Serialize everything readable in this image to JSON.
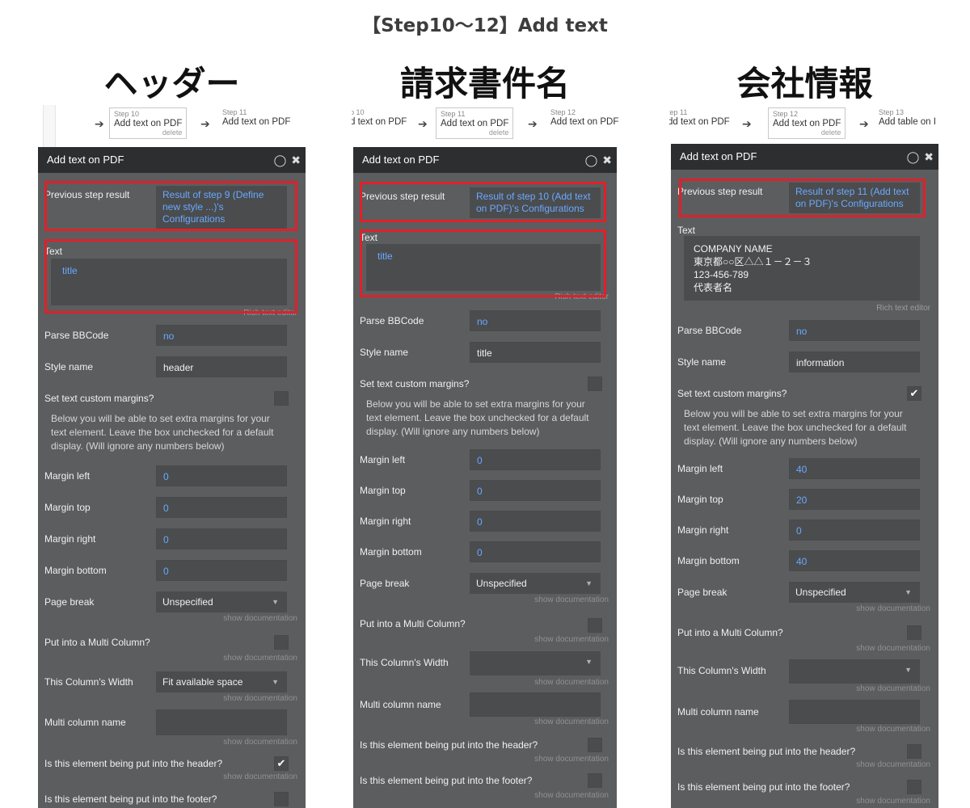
{
  "caption": "【Step10〜12】Add text",
  "columns": [
    {
      "title": "ヘッダー",
      "steps": {
        "prev": {
          "num": "Step 10",
          "label": "Add text on PDF",
          "delete": "delete"
        },
        "next": {
          "num": "Step 11",
          "label": "Add text on PDF"
        }
      },
      "panel_title": "Add text on PDF",
      "previous_step_label": "Previous step result",
      "previous_step_value": "Result of step 9 (Define new style ...)'s Configurations",
      "text_label": "Text",
      "text_value": "title",
      "rich_text": "Rich text editor",
      "parse_label": "Parse BBCode",
      "parse_value": "no",
      "style_label": "Style name",
      "style_value": "header",
      "margins_q": "Set text custom margins?",
      "margins_checked": false,
      "note": "Below you will be able to set extra margins for your text element. Leave the box unchecked for a default display. (Will ignore any numbers below)",
      "ml_label": "Margin left",
      "ml": "0",
      "mt_label": "Margin top",
      "mt": "0",
      "mr_label": "Margin right",
      "mr": "0",
      "mb_label": "Margin bottom",
      "mb": "0",
      "pb_label": "Page break",
      "pb": "Unspecified",
      "show_doc": "show documentation",
      "multi_label": "Put into a Multi Column?",
      "width_label": "This Column's Width",
      "width_value": "Fit available space",
      "mcname_label": "Multi column name",
      "header_q": "Is this element being put into the header?",
      "header_checked": true,
      "footer_q": "Is this element being put into the footer?"
    },
    {
      "title": "請求書件名",
      "steps": {
        "prev": {
          "num": "p 10",
          "label": "d text on PDF"
        },
        "sel": {
          "num": "Step 11",
          "label": "Add text on PDF",
          "delete": "delete"
        },
        "next": {
          "num": "Step 12",
          "label": "Add text on PDF"
        }
      },
      "panel_title": "Add text on PDF",
      "previous_step_label": "Previous step result",
      "previous_step_value": "Result of step 10 (Add text on PDF)'s Configurations",
      "text_label": "Text",
      "text_value": "title",
      "rich_text": "Rich text editor",
      "parse_label": "Parse BBCode",
      "parse_value": "no",
      "style_label": "Style name",
      "style_value": "title",
      "margins_q": "Set text custom margins?",
      "margins_checked": false,
      "note": "Below you will be able to set extra margins for your text element. Leave the box unchecked for a default display. (Will ignore any numbers below)",
      "ml_label": "Margin left",
      "ml": "0",
      "mt_label": "Margin top",
      "mt": "0",
      "mr_label": "Margin right",
      "mr": "0",
      "mb_label": "Margin bottom",
      "mb": "0",
      "pb_label": "Page break",
      "pb": "Unspecified",
      "show_doc": "show documentation",
      "multi_label": "Put into a Multi Column?",
      "width_label": "This Column's Width",
      "width_value": "",
      "mcname_label": "Multi column name",
      "header_q": "Is this element being put into the header?",
      "footer_q": "Is this element being put into the footer?"
    },
    {
      "title": "会社情報",
      "steps": {
        "prev": {
          "num": "tep 11",
          "label": "dd text on PDF"
        },
        "sel": {
          "num": "Step 12",
          "label": "Add text on PDF",
          "delete": "delete"
        },
        "next": {
          "num": "Step 13",
          "label": "Add table on I"
        }
      },
      "panel_title": "Add text on PDF",
      "previous_step_label": "Previous step result",
      "previous_step_value": "Result of step 11 (Add text on PDF)'s Configurations",
      "text_label": "Text",
      "text_lines": [
        "COMPANY NAME",
        "東京都○○区△△１－２－３",
        "123-456-789",
        "代表者名"
      ],
      "rich_text": "Rich text editor",
      "parse_label": "Parse BBCode",
      "parse_value": "no",
      "style_label": "Style name",
      "style_value": "information",
      "margins_q": "Set text custom margins?",
      "margins_checked": true,
      "note": "Below you will be able to set extra margins for your text element. Leave the box unchecked for a default display. (Will ignore any numbers below)",
      "ml_label": "Margin left",
      "ml": "40",
      "mt_label": "Margin top",
      "mt": "20",
      "mr_label": "Margin right",
      "mr": "0",
      "mb_label": "Margin bottom",
      "mb": "40",
      "pb_label": "Page break",
      "pb": "Unspecified",
      "show_doc": "show documentation",
      "multi_label": "Put into a Multi Column?",
      "width_label": "This Column's Width",
      "width_value": "",
      "mcname_label": "Multi column name",
      "header_q": "Is this element being put into the header?",
      "footer_q": "Is this element being put into the footer?"
    }
  ]
}
